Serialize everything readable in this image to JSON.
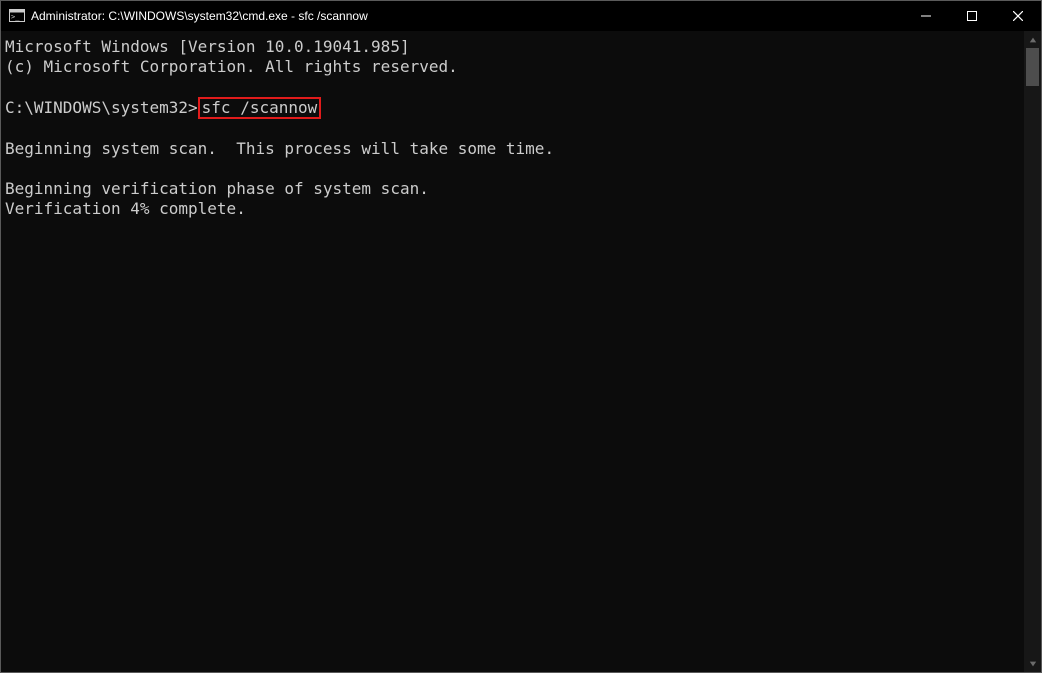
{
  "title": "Administrator: C:\\WINDOWS\\system32\\cmd.exe - sfc  /scannow",
  "terminal": {
    "header1": "Microsoft Windows [Version 10.0.19041.985]",
    "header2": "(c) Microsoft Corporation. All rights reserved.",
    "prompt": "C:\\WINDOWS\\system32>",
    "command": "sfc /scannow",
    "begin_scan": "Beginning system scan.  This process will take some time.",
    "begin_verify": "Beginning verification phase of system scan.",
    "progress": "Verification 4% complete."
  }
}
